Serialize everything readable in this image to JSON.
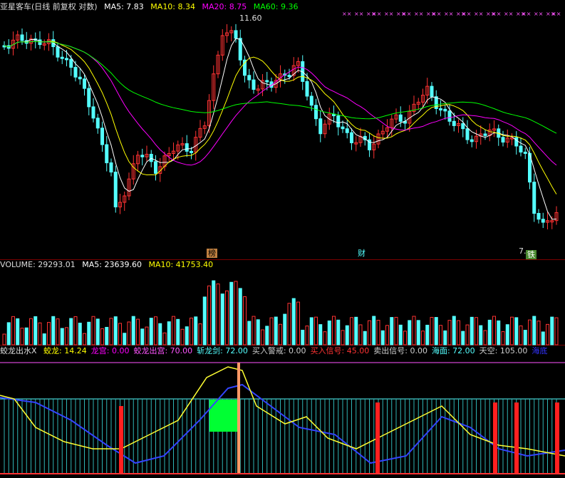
{
  "kline": {
    "stock_name": "亚星客车",
    "mode": "(日线 前复权 对数)",
    "ma5_label": "MA5: 7.83",
    "ma10_label": "MA10: 8.34",
    "ma20_label": "MA20: 8.75",
    "ma60_label": "MA60: 9.36",
    "high_label": "11.60",
    "low_label": "7.",
    "marker_bang": "榜",
    "marker_cai": "财",
    "marker_tie": "铁",
    "colors": {
      "ma5": "#ffffff",
      "ma10": "#ffff00",
      "ma20": "#ff00ff",
      "ma60": "#00ff00",
      "up": "#ff3333",
      "down": "#54ffff"
    }
  },
  "volume": {
    "label": "VOLUME: 29293.01",
    "ma5_label": "MA5: 23639.60",
    "ma10_label": "MA10: 41753.40"
  },
  "indicator": {
    "name": "蛟龙出水X",
    "items": [
      {
        "label": "蛟龙: 14.24",
        "color": "#ffff00"
      },
      {
        "label": "龙宫: 0.00",
        "color": "#ff00ff"
      },
      {
        "label": "蛟龙出宫: 70.00",
        "color": "#ff55ff"
      },
      {
        "label": "斩龙剑: 72.00",
        "color": "#54ffff"
      },
      {
        "label": "买入警戒: 0.00",
        "color": "#cccccc"
      },
      {
        "label": "买入信号: 45.00",
        "color": "#ff3333"
      },
      {
        "label": "卖出信号: 0.00",
        "color": "#cccccc"
      },
      {
        "label": "海面: 72.00",
        "color": "#54ffff"
      },
      {
        "label": "天空: 105.00",
        "color": "#cccccc"
      },
      {
        "label": "海底",
        "color": "#3333ff"
      }
    ]
  }
}
